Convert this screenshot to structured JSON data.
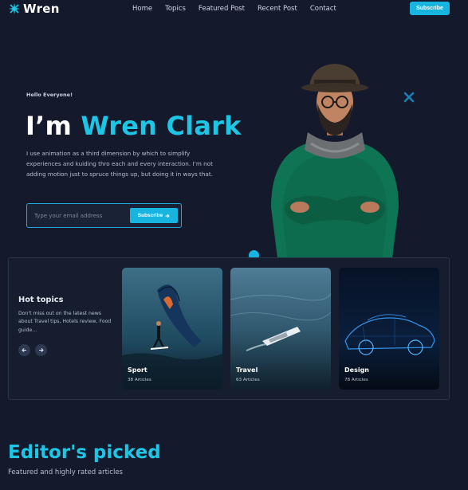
{
  "nav": {
    "brand": "Wren",
    "links": [
      "Home",
      "Topics",
      "Featured Post",
      "Recent Post",
      "Contact"
    ],
    "subscribe_label": "Subscribe"
  },
  "hero": {
    "greeting": "Hello Everyone!",
    "title_prefix": "I’m",
    "title_name": "Wren Clark",
    "description": "I use animation as a third dimension by which to simplify experiences and kuiding thro each and every interaction. I’m not adding motion just to spruce things up, but doing it in ways that.",
    "email_placeholder": "Type your email address",
    "subscribe_label": "Subscribe"
  },
  "hot_topics": {
    "title": "Hot topics",
    "description": "Don't miss out on the latest news about Travel tips, Hotels review, Food guide...",
    "cards": [
      {
        "title": "Sport",
        "count": "38 Articles"
      },
      {
        "title": "Travel",
        "count": "63 Articles"
      },
      {
        "title": "Design",
        "count": "78 Articles"
      }
    ]
  },
  "editor": {
    "title": "Editor's picked",
    "subtitle": "Featured and highly rated articles"
  },
  "colors": {
    "background": "#141a2b",
    "accent": "#18b4e0",
    "heading_accent": "#1ec6e6"
  }
}
